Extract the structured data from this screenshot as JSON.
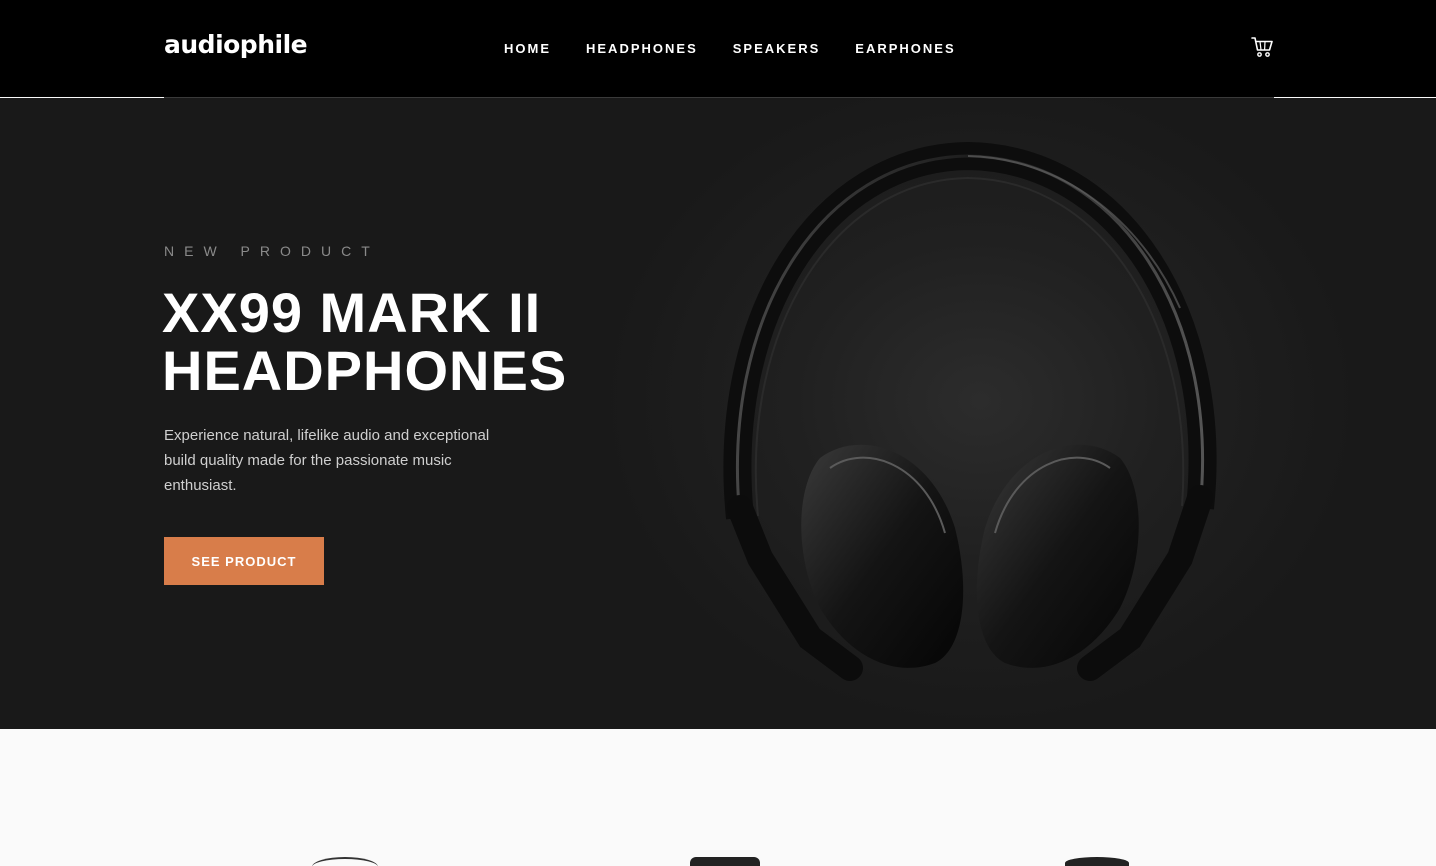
{
  "header": {
    "logo": "audiophile",
    "nav": [
      "HOME",
      "HEADPHONES",
      "SPEAKERS",
      "EARPHONES"
    ],
    "cart_icon": "cart-icon"
  },
  "hero": {
    "overline": "NEW PRODUCT",
    "title_line1": "XX99 MARK II",
    "title_line2": "HEADPHONES",
    "description": "Experience natural, lifelike audio and exceptional build quality made for the passionate music enthusiast.",
    "cta_label": "SEE PRODUCT",
    "image_icon": "headphones-image"
  },
  "colors": {
    "accent": "#d87d4a",
    "header_bg": "#000000",
    "hero_bg": "#191919",
    "page_bg": "#fafafa"
  }
}
